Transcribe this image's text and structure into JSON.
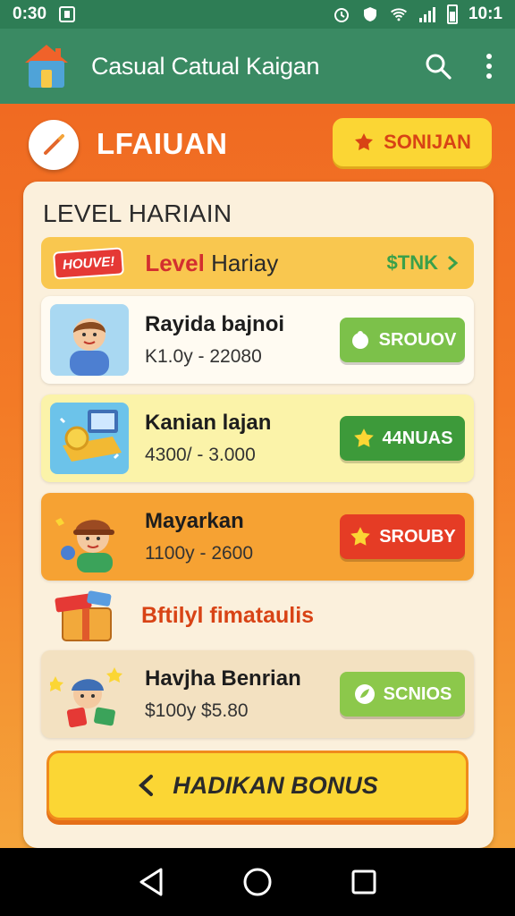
{
  "status_bar": {
    "time_left": "0:30",
    "time_right": "10:1"
  },
  "app_bar": {
    "title": "Casual Catual Kaigan"
  },
  "header": {
    "title": "LFAIUAN",
    "button_label": "SONIJAN"
  },
  "card": {
    "title": "LEVEL HARIAIN",
    "banner": {
      "badge": "HOUVE!",
      "title_red": "Level",
      "title_dark": "Hariay",
      "link": "$TNK"
    },
    "items": [
      {
        "name": "Rayida bajnoi",
        "range": "K1.0y - 22080",
        "button": "SROUOV",
        "color": "#7cc14a",
        "bg": "#fffbf2"
      },
      {
        "name": "Kanian  lajan",
        "range": "4300/ - 3.000",
        "button": "44NUAS",
        "color": "#3d9a3a",
        "bg": "#fbf3a9"
      },
      {
        "name": "Mayarkan",
        "range": "1100y - 2600",
        "button": "SROUBY",
        "color": "#e53c25",
        "bg": "#f6a233"
      }
    ],
    "gift_title": "Bftilyl fimataulis",
    "special": {
      "name": "Havjha Benrian",
      "range": "$100y  $5.80",
      "button": "SCNIOS",
      "color": "#8cc84b",
      "bg": "#f3e1c1"
    },
    "bonus_button": "HADIKAN BONUS"
  }
}
